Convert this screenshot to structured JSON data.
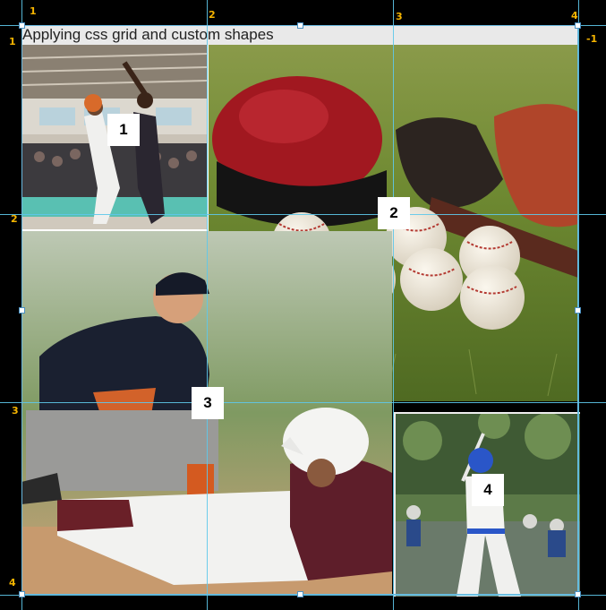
{
  "title": "Applying css grid and custom shapes",
  "column_labels": [
    "1",
    "2",
    "3",
    "4"
  ],
  "row_labels": [
    "1",
    "2",
    "3",
    "4"
  ],
  "negative_label": "-1",
  "badges": [
    "1",
    "2",
    "3",
    "4"
  ],
  "images": {
    "tile1": "basketball players layup",
    "tile2": "baseball helmet, glove, bat and balls on grass",
    "tile3": "baseball player sliding into base",
    "tile4": "young baseball batter in blue uniform"
  },
  "colors": {
    "background": "#000000",
    "grid_line": "#5ec8ea",
    "grid_label": "#f5b400",
    "title_bar": "#e9e9e9"
  }
}
